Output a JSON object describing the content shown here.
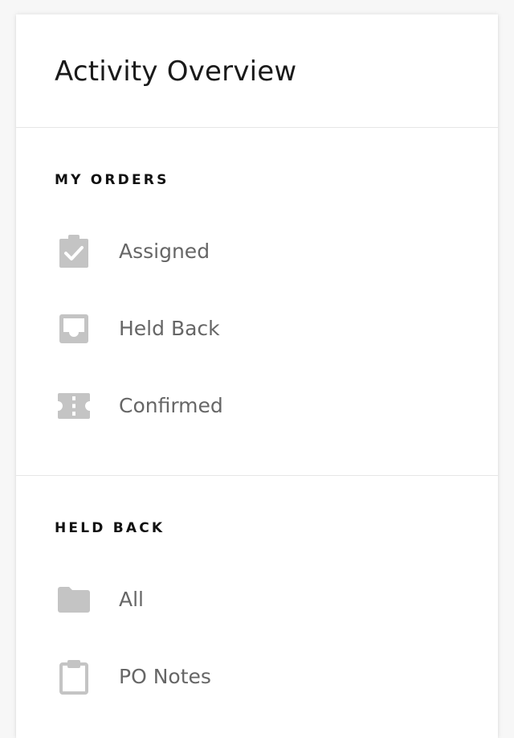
{
  "header": {
    "title": "Activity Overview"
  },
  "my_orders": {
    "heading": "MY ORDERS",
    "items": [
      {
        "label": "Assigned",
        "icon": "assignment-check-icon"
      },
      {
        "label": "Held Back",
        "icon": "inbox-icon"
      },
      {
        "label": "Confirmed",
        "icon": "ticket-icon"
      }
    ]
  },
  "held_back": {
    "heading": "HELD BACK",
    "items": [
      {
        "label": "All",
        "icon": "folder-icon"
      },
      {
        "label": "PO Notes",
        "icon": "clipboard-icon"
      }
    ]
  },
  "colors": {
    "icon": "#c4c4c4",
    "label": "#666666",
    "heading": "#111111",
    "divider": "#e6e6e6"
  }
}
